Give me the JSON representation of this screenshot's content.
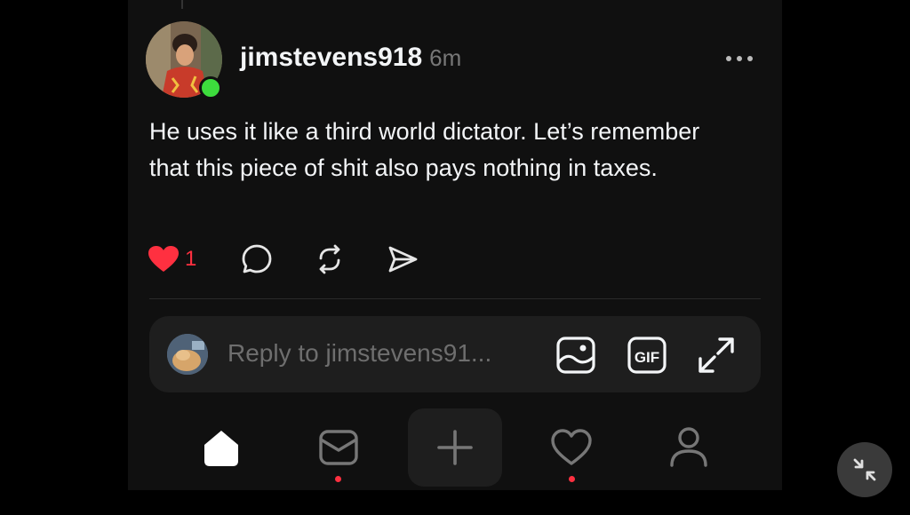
{
  "post": {
    "username": "jimstevens918",
    "timestamp": "6m",
    "body": "He uses it like a third world dictator. Let’s remember that this piece of shit also pays nothing in taxes.",
    "like_count": "1"
  },
  "reply": {
    "placeholder": "Reply to jimstevens91...",
    "gif_label": "GIF"
  },
  "icons": {
    "more": "more-icon",
    "like": "heart-icon",
    "comment": "comment-icon",
    "repost": "repost-icon",
    "share": "send-icon",
    "image": "image-icon",
    "gif": "gif-icon",
    "expand": "expand-icon",
    "home": "home-icon",
    "inbox": "inbox-icon",
    "create": "plus-icon",
    "activity": "heart-icon",
    "profile": "profile-icon",
    "collapse": "collapse-icon"
  },
  "colors": {
    "background": "#101010",
    "text": "#f3f5f7",
    "muted": "#777777",
    "like": "#ff3040",
    "online": "#3ddc3d"
  }
}
